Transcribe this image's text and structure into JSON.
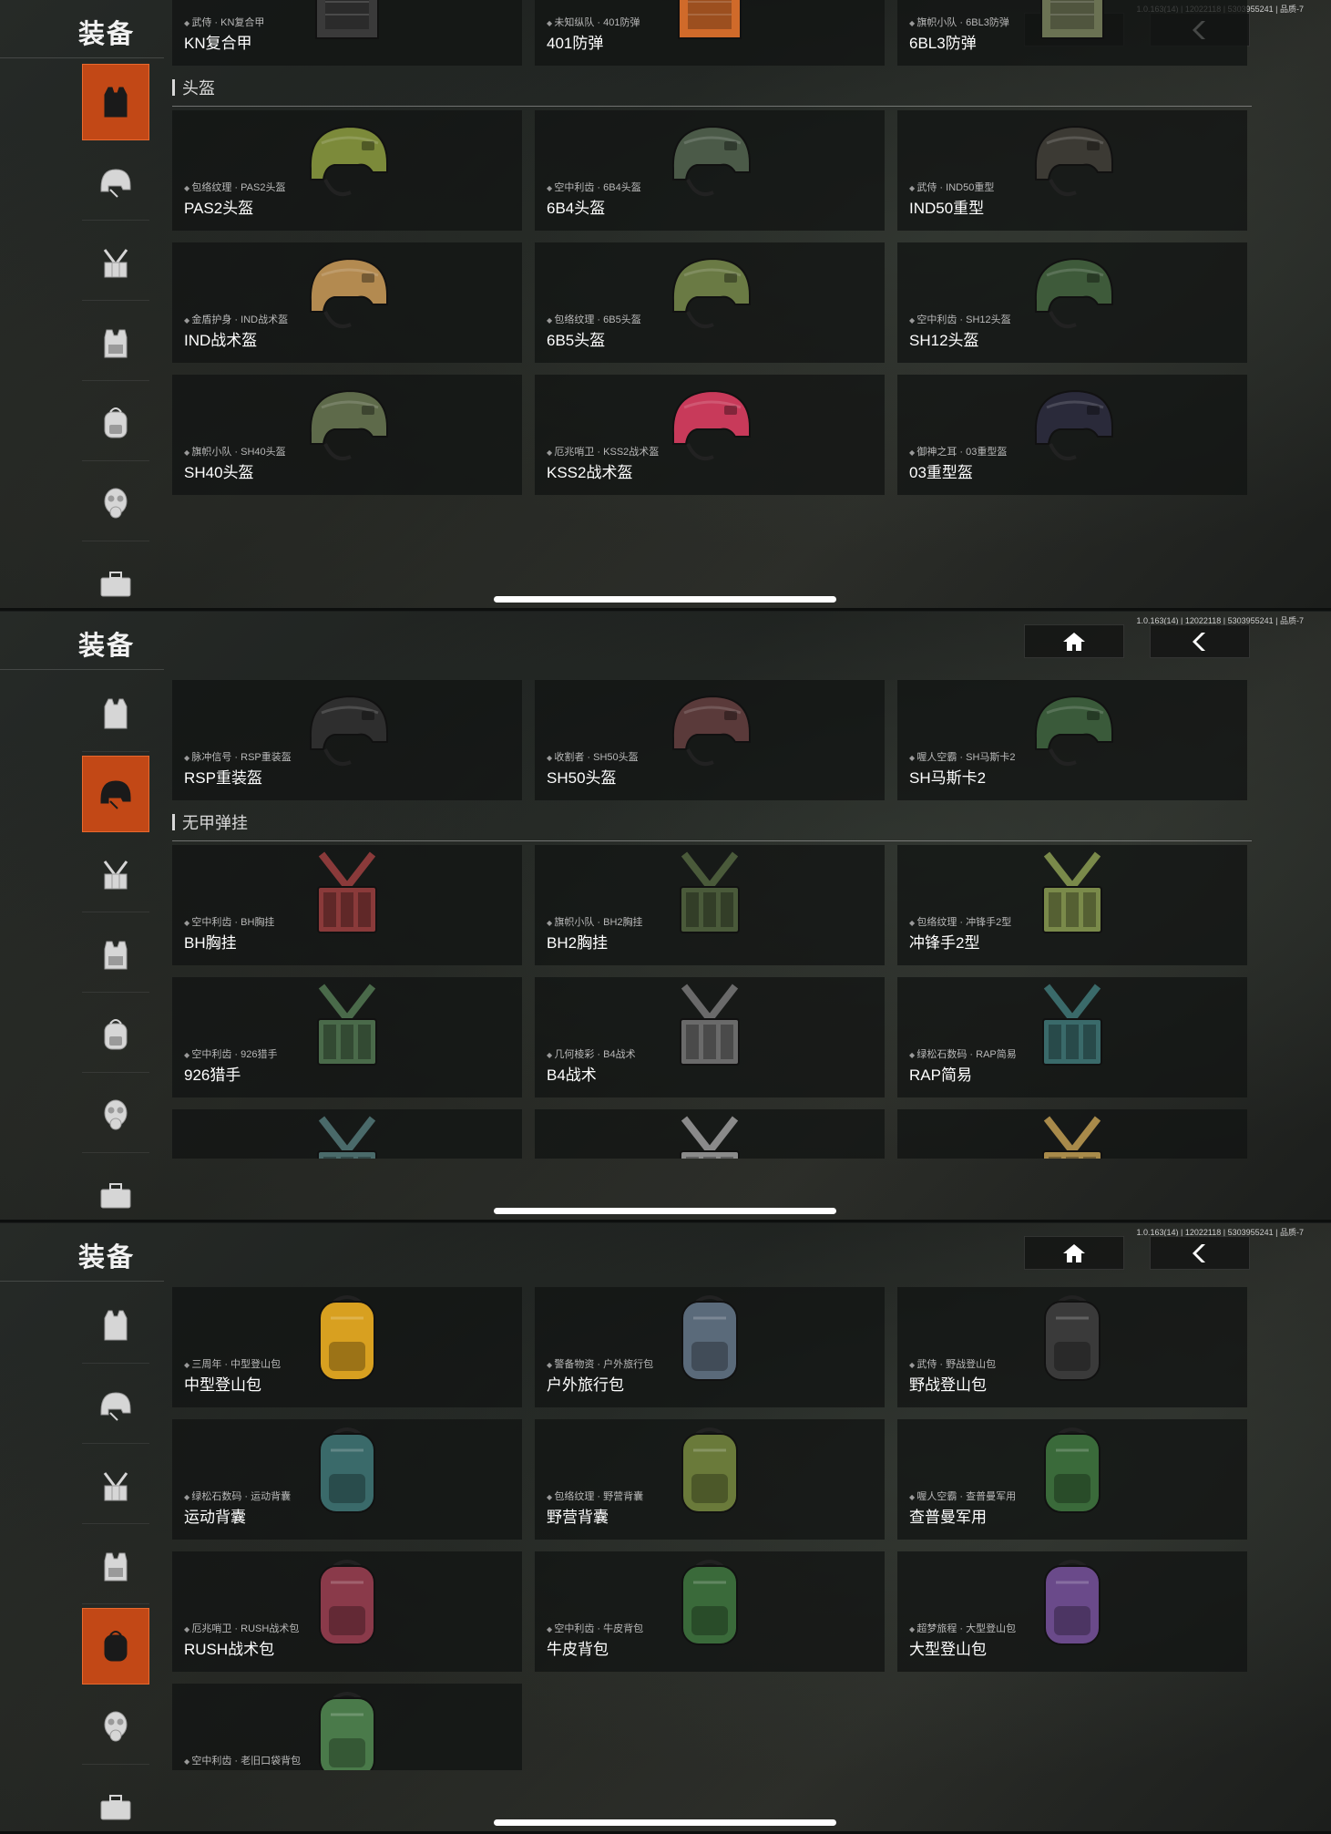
{
  "app": {
    "title": "装备",
    "version": "1.0.163(14) | 12022118 | 5303955241 | 品质-7"
  },
  "colors": {
    "accent": "#c24816",
    "card_bg": "#121413",
    "text": "#ffffff"
  },
  "sidebar_icons": [
    "vest-icon",
    "helmet-icon",
    "chest-rig-icon",
    "plate-carrier-icon",
    "backpack-icon",
    "gas-mask-icon",
    "toolbox-icon"
  ],
  "panel1": {
    "active_tab": 0,
    "top_row": [
      {
        "sub": "武侍 · KN复合甲",
        "name": "KN复合甲",
        "icon": "armor-vest-icon",
        "color": "#3a3a3a"
      },
      {
        "sub": "未知纵队 · 401防弹",
        "name": "401防弹",
        "icon": "armor-vest-icon",
        "color": "#d06a2a"
      },
      {
        "sub": "旗帜小队 · 6BL3防弹",
        "name": "6BL3防弹",
        "icon": "armor-vest-icon",
        "color": "#6b7253"
      }
    ],
    "section": "头盔",
    "items": [
      {
        "sub": "包络纹理 · PAS2头盔",
        "name": "PAS2头盔",
        "icon": "helmet-icon",
        "color": "#7c8a3a"
      },
      {
        "sub": "空中利齿 · 6B4头盔",
        "name": "6B4头盔",
        "icon": "helmet-icon",
        "color": "#4b5a48"
      },
      {
        "sub": "武侍 · IND50重型",
        "name": "IND50重型",
        "icon": "helmet-icon",
        "color": "#3c3a34"
      },
      {
        "sub": "金盾护身 · IND战术盔",
        "name": "IND战术盔",
        "icon": "helmet-icon",
        "color": "#b38a50"
      },
      {
        "sub": "包络纹理 · 6B5头盔",
        "name": "6B5头盔",
        "icon": "helmet-icon",
        "color": "#6a7a44"
      },
      {
        "sub": "空中利齿 · SH12头盔",
        "name": "SH12头盔",
        "icon": "helmet-icon",
        "color": "#3e5a3a"
      },
      {
        "sub": "旗帜小队 · SH40头盔",
        "name": "SH40头盔",
        "icon": "helmet-icon",
        "color": "#5e6a4a"
      },
      {
        "sub": "厄兆哨卫 · KSS2战术盔",
        "name": "KSS2战术盔",
        "icon": "helmet-icon",
        "color": "#c83a5a"
      },
      {
        "sub": "御神之耳 · 03重型盔",
        "name": "03重型盔",
        "icon": "helmet-icon",
        "color": "#2a2a3a"
      }
    ]
  },
  "panel2": {
    "active_tab": 1,
    "top_row": [
      {
        "sub": "脉冲信号 · RSP重装盔",
        "name": "RSP重装盔",
        "icon": "helmet-icon",
        "color": "#2e2e2e"
      },
      {
        "sub": "收割者 · SH50头盔",
        "name": "SH50头盔",
        "icon": "helmet-icon",
        "color": "#5a3a3a"
      },
      {
        "sub": "喔人空霸 · SH马斯卡2",
        "name": "SH马斯卡2",
        "icon": "helmet-icon",
        "color": "#3a5a3a"
      }
    ],
    "section": "无甲弹挂",
    "items": [
      {
        "sub": "空中利齿 · BH胸挂",
        "name": "BH胸挂",
        "icon": "chest-rig-icon",
        "color": "#8a3a3a"
      },
      {
        "sub": "旗帜小队 · BH2胸挂",
        "name": "BH2胸挂",
        "icon": "chest-rig-icon",
        "color": "#4a5a3a"
      },
      {
        "sub": "包络纹理 · 冲锋手2型",
        "name": "冲锋手2型",
        "icon": "chest-rig-icon",
        "color": "#7a8a4a"
      },
      {
        "sub": "空中利齿 · 926猎手",
        "name": "926猎手",
        "icon": "chest-rig-icon",
        "color": "#4a6a4a"
      },
      {
        "sub": "几何棱彩 · B4战术",
        "name": "B4战术",
        "icon": "chest-rig-icon",
        "color": "#6a6a6a"
      },
      {
        "sub": "绿松石数码 · RAP简易",
        "name": "RAP简易",
        "icon": "chest-rig-icon",
        "color": "#3a6a6a"
      },
      {
        "sub": "",
        "name": "",
        "icon": "chest-rig-icon",
        "color": "#4a6a6a"
      },
      {
        "sub": "",
        "name": "",
        "icon": "chest-rig-icon",
        "color": "#8a8a8a"
      },
      {
        "sub": "",
        "name": "",
        "icon": "chest-rig-icon",
        "color": "#a88a4a"
      }
    ]
  },
  "panel3": {
    "active_tab": 4,
    "items": [
      {
        "sub": "三周年 · 中型登山包",
        "name": "中型登山包",
        "icon": "backpack-icon",
        "color": "#d8a020"
      },
      {
        "sub": "警备物资 · 户外旅行包",
        "name": "户外旅行包",
        "icon": "backpack-icon",
        "color": "#5a6a7a"
      },
      {
        "sub": "武侍 · 野战登山包",
        "name": "野战登山包",
        "icon": "backpack-icon",
        "color": "#3a3a3a"
      },
      {
        "sub": "绿松石数码 · 运动背囊",
        "name": "运动背囊",
        "icon": "backpack-icon",
        "color": "#3a6a6a"
      },
      {
        "sub": "包络纹理 · 野营背囊",
        "name": "野营背囊",
        "icon": "backpack-icon",
        "color": "#6a7a3a"
      },
      {
        "sub": "喔人空霸 · 查普曼军用",
        "name": "查普曼军用",
        "icon": "backpack-icon",
        "color": "#3a6a3a"
      },
      {
        "sub": "厄兆哨卫 · RUSH战术包",
        "name": "RUSH战术包",
        "icon": "backpack-icon",
        "color": "#8a3a4a"
      },
      {
        "sub": "空中利齿 · 牛皮背包",
        "name": "牛皮背包",
        "icon": "backpack-icon",
        "color": "#3a6a3a"
      },
      {
        "sub": "超梦旅程 · 大型登山包",
        "name": "大型登山包",
        "icon": "backpack-icon",
        "color": "#6a4a8a"
      },
      {
        "sub": "空中利齿 · 老旧口袋背包",
        "name": "老旧口袋背包",
        "icon": "backpack-icon",
        "color": "#4a7a4a"
      }
    ]
  }
}
